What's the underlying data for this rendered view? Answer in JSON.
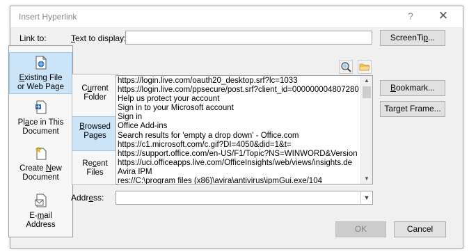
{
  "window": {
    "title": "Insert Hyperlink",
    "help_glyph": "?",
    "close_glyph": "✕"
  },
  "link_to": {
    "label": "Link to:",
    "items": [
      {
        "pre": "",
        "key": "E",
        "post": "xisting File",
        "line2": "or Web Page",
        "icon": "web-page-icon",
        "selected": true
      },
      {
        "pre": "Pl",
        "key": "a",
        "post": "ce in This",
        "line2": "Document",
        "icon": "place-in-document-icon",
        "selected": false
      },
      {
        "pre": "Create ",
        "key": "N",
        "post": "ew",
        "line2": "Document",
        "icon": "new-document-icon",
        "selected": false
      },
      {
        "pre": "E-",
        "key": "m",
        "post": "ail",
        "line2": "Address",
        "icon": "email-address-icon",
        "selected": false
      }
    ]
  },
  "text_to_display": {
    "pre": "",
    "key": "T",
    "post": "ext to display:",
    "value": ""
  },
  "buttons": {
    "screentip_pre": "ScreenTi",
    "screentip_key": "p",
    "screentip_post": "...",
    "bookmark_pre": "",
    "bookmark_key": "B",
    "bookmark_post": "ookmark...",
    "target_pre": "Tar",
    "target_key": "g",
    "target_post": "et Frame...",
    "ok": "OK",
    "cancel": "Cancel"
  },
  "look_in": {
    "items": [
      {
        "pre": "C",
        "key": "u",
        "post": "rrent",
        "line2": "Folder",
        "selected": false
      },
      {
        "pre": "",
        "key": "B",
        "post": "rowsed",
        "line2": "Pages",
        "selected": true
      },
      {
        "pre": "Re",
        "key": "c",
        "post": "ent",
        "line2": "Files",
        "selected": false
      }
    ]
  },
  "browsed_pages": [
    "https://login.live.com/oauth20_desktop.srf?lc=1033",
    "https://login.live.com/ppsecure/post.srf?client_id=000000004807280",
    "Help us protect your account",
    "Sign in to your Microsoft account",
    "Sign in",
    "Office Add-ins",
    "Search results for 'empty a drop down' - Office.com",
    "https://c1.microsoft.com/c.gif?DI=4050&did=1&t=",
    "https://support.office.com/en-US/F1/Topic?NS=WINWORD&Version",
    "https://uci.officeapps.live.com/OfficeInsights/web/views/insights.de",
    "Avira IPM",
    "res://C:\\program files (x86)\\avira\\antivirus\\ipmGui.exe/104"
  ],
  "address": {
    "pre": "Addr",
    "key": "e",
    "post": "ss:",
    "value": ""
  },
  "colors": {
    "selected_bg": "#cce4f7",
    "selected_border": "#99c9ef",
    "dialog_bg": "#f0f0f0"
  }
}
